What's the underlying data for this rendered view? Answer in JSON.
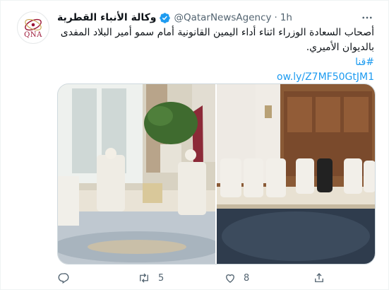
{
  "tweet": {
    "account_name": "وكالة الأنباء القطرية",
    "handle": "@QatarNewsAgency",
    "separator": "·",
    "time": "1h",
    "avatar_text": "QNA",
    "text_line1": "أصحاب السعادة الوزراء اثناء أداء اليمين القانونية أمام سمو أمير البلاد المفدى",
    "text_line2": "بالديوان الأميري.",
    "hashtag": "#قنا",
    "url": "ow.ly/Z7MF50GtJM1"
  },
  "actions": {
    "reply_count": "",
    "retweet_count": "5",
    "like_count": "8",
    "share_count": ""
  },
  "icons": {
    "verified": "verified-badge-icon",
    "more": "more-options-icon",
    "reply": "reply-icon",
    "retweet": "retweet-icon",
    "like": "heart-icon",
    "share": "share-icon"
  },
  "colors": {
    "link": "#1d9bf0",
    "verified": "#1d9bf0",
    "secondary_text": "#536471",
    "avatar_brand": "#9b1535"
  }
}
